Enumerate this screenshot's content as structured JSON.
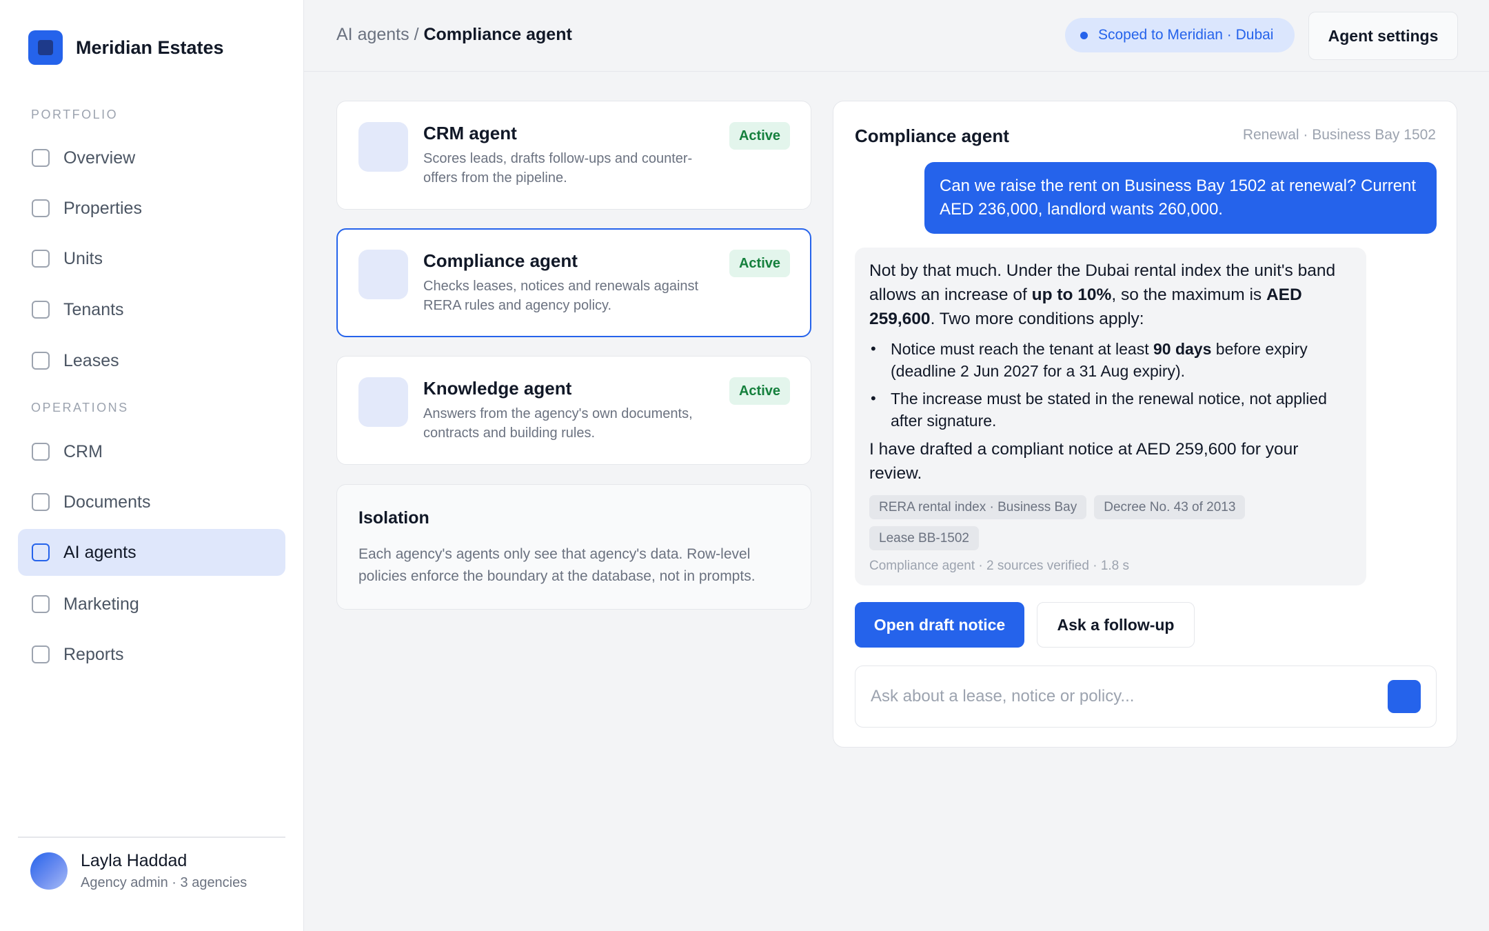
{
  "brand": {
    "name": "Meridian Estates",
    "logo_icon": "building-logo-icon"
  },
  "sidebar": {
    "sections": [
      {
        "label": "PORTFOLIO"
      },
      {
        "label": "OPERATIONS"
      }
    ],
    "items": [
      {
        "label": "Overview"
      },
      {
        "label": "Properties"
      },
      {
        "label": "Units"
      },
      {
        "label": "Tenants"
      },
      {
        "label": "Leases"
      },
      {
        "label": "CRM"
      },
      {
        "label": "Documents"
      },
      {
        "label": "AI agents",
        "active": true
      },
      {
        "label": "Marketing"
      },
      {
        "label": "Reports"
      }
    ]
  },
  "user": {
    "name": "Layla Haddad",
    "role": "Agency admin · 3 agencies"
  },
  "header": {
    "breadcrumb_parent": "AI agents",
    "breadcrumb_separator": " / ",
    "breadcrumb_current": "Compliance agent",
    "scope_label": "Scoped to Meridian · Dubai",
    "settings_label": "Agent settings"
  },
  "agents": [
    {
      "name": "CRM agent",
      "description": "Scores leads, drafts follow-ups and counter-offers from the pipeline.",
      "status": "Active"
    },
    {
      "name": "Compliance agent",
      "description": "Checks leases, notices and renewals against RERA rules and agency policy.",
      "status": "Active",
      "selected": true
    },
    {
      "name": "Knowledge agent",
      "description": "Answers from the agency's own documents, contracts and building rules.",
      "status": "Active"
    }
  ],
  "isolation": {
    "title": "Isolation",
    "body": "Each agency's agents only see that agency's data. Row-level policies enforce the boundary at the database, not in prompts."
  },
  "chat": {
    "title": "Compliance agent",
    "context": "Renewal · Business Bay 1502",
    "user_message": "Can we raise the rent on Business Bay 1502 at renewal? Current AED 236,000, landlord wants 260,000.",
    "reply": {
      "p1_a": "Not by that much. Under the Dubai rental index the unit's band allows an increase of ",
      "p1_b": "up to 10%",
      "p1_c": ", so the maximum is ",
      "p1_d": "AED 259,600",
      "p1_e": ". Two more conditions apply:",
      "bullet1_a": "Notice must reach the tenant at least ",
      "bullet1_b": "90 days",
      "bullet1_c": " before expiry (deadline 2 Jun 2027 for a 31 Aug expiry).",
      "bullet2": "The increase must be stated in the renewal notice, not applied after signature.",
      "p2": "I have drafted a compliant notice at AED 259,600 for your review.",
      "sources": [
        "RERA rental index · Business Bay",
        "Decree No. 43 of 2013",
        "Lease BB-1502"
      ],
      "meta": "Compliance agent · 2 sources verified · 1.8 s"
    },
    "primary_action": "Open draft notice",
    "secondary_action": "Ask a follow-up",
    "composer_placeholder": "Ask about a lease, notice or policy...",
    "composer_value": "",
    "send_icon": "send-icon"
  },
  "colors": {
    "accent": "#2563eb",
    "active_nav_bg": "#dfe7fb",
    "status_green": "#15803d",
    "status_green_bg": "#e3f5ec",
    "page_bg": "#f3f4f6"
  }
}
